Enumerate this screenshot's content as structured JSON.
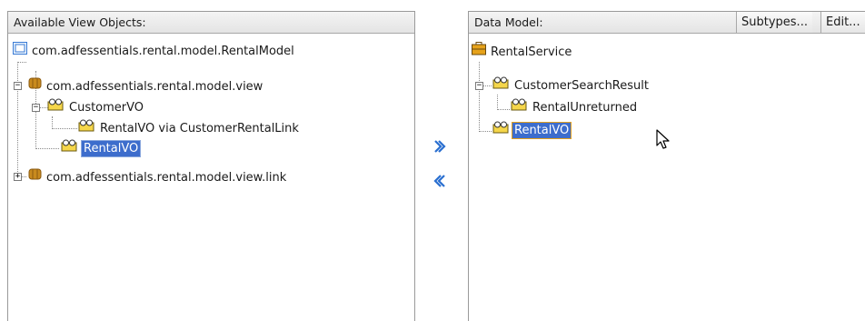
{
  "left_panel": {
    "header": "Available View Objects:",
    "tree": [
      {
        "label": "com.adfessentials.rental.model.RentalModel",
        "icon": "application-module-folder-icon"
      },
      {
        "label": "com.adfessentials.rental.model.view",
        "icon": "package-icon",
        "expanded": true
      },
      {
        "label": "CustomerVO",
        "icon": "view-object-icon",
        "expanded": true
      },
      {
        "label": "RentalVO via CustomerRentalLink",
        "icon": "view-object-icon"
      },
      {
        "label": "RentalVO",
        "icon": "view-object-icon",
        "selected": true
      },
      {
        "label": "com.adfessentials.rental.model.view.link",
        "icon": "package-icon",
        "expanded": false
      }
    ]
  },
  "shuttle": {
    "add_icon": "double-chevron-right-icon",
    "remove_icon": "double-chevron-left-icon",
    "accent": "#2a6fd0"
  },
  "right_panel": {
    "header": "Data Model:",
    "subtypes_label": "Subtypes...",
    "edit_label": "Edit...",
    "tree": [
      {
        "label": "RentalService",
        "icon": "application-module-briefcase-icon"
      },
      {
        "label": "CustomerSearchResult",
        "icon": "view-object-instance-icon",
        "expanded": true
      },
      {
        "label": "RentalUnreturned",
        "icon": "view-object-instance-icon"
      },
      {
        "label": "RentalVO",
        "icon": "view-object-instance-icon",
        "selected": true
      }
    ]
  },
  "colors": {
    "selection": "#3d6dcc",
    "focus_outline": "#e0a020"
  }
}
